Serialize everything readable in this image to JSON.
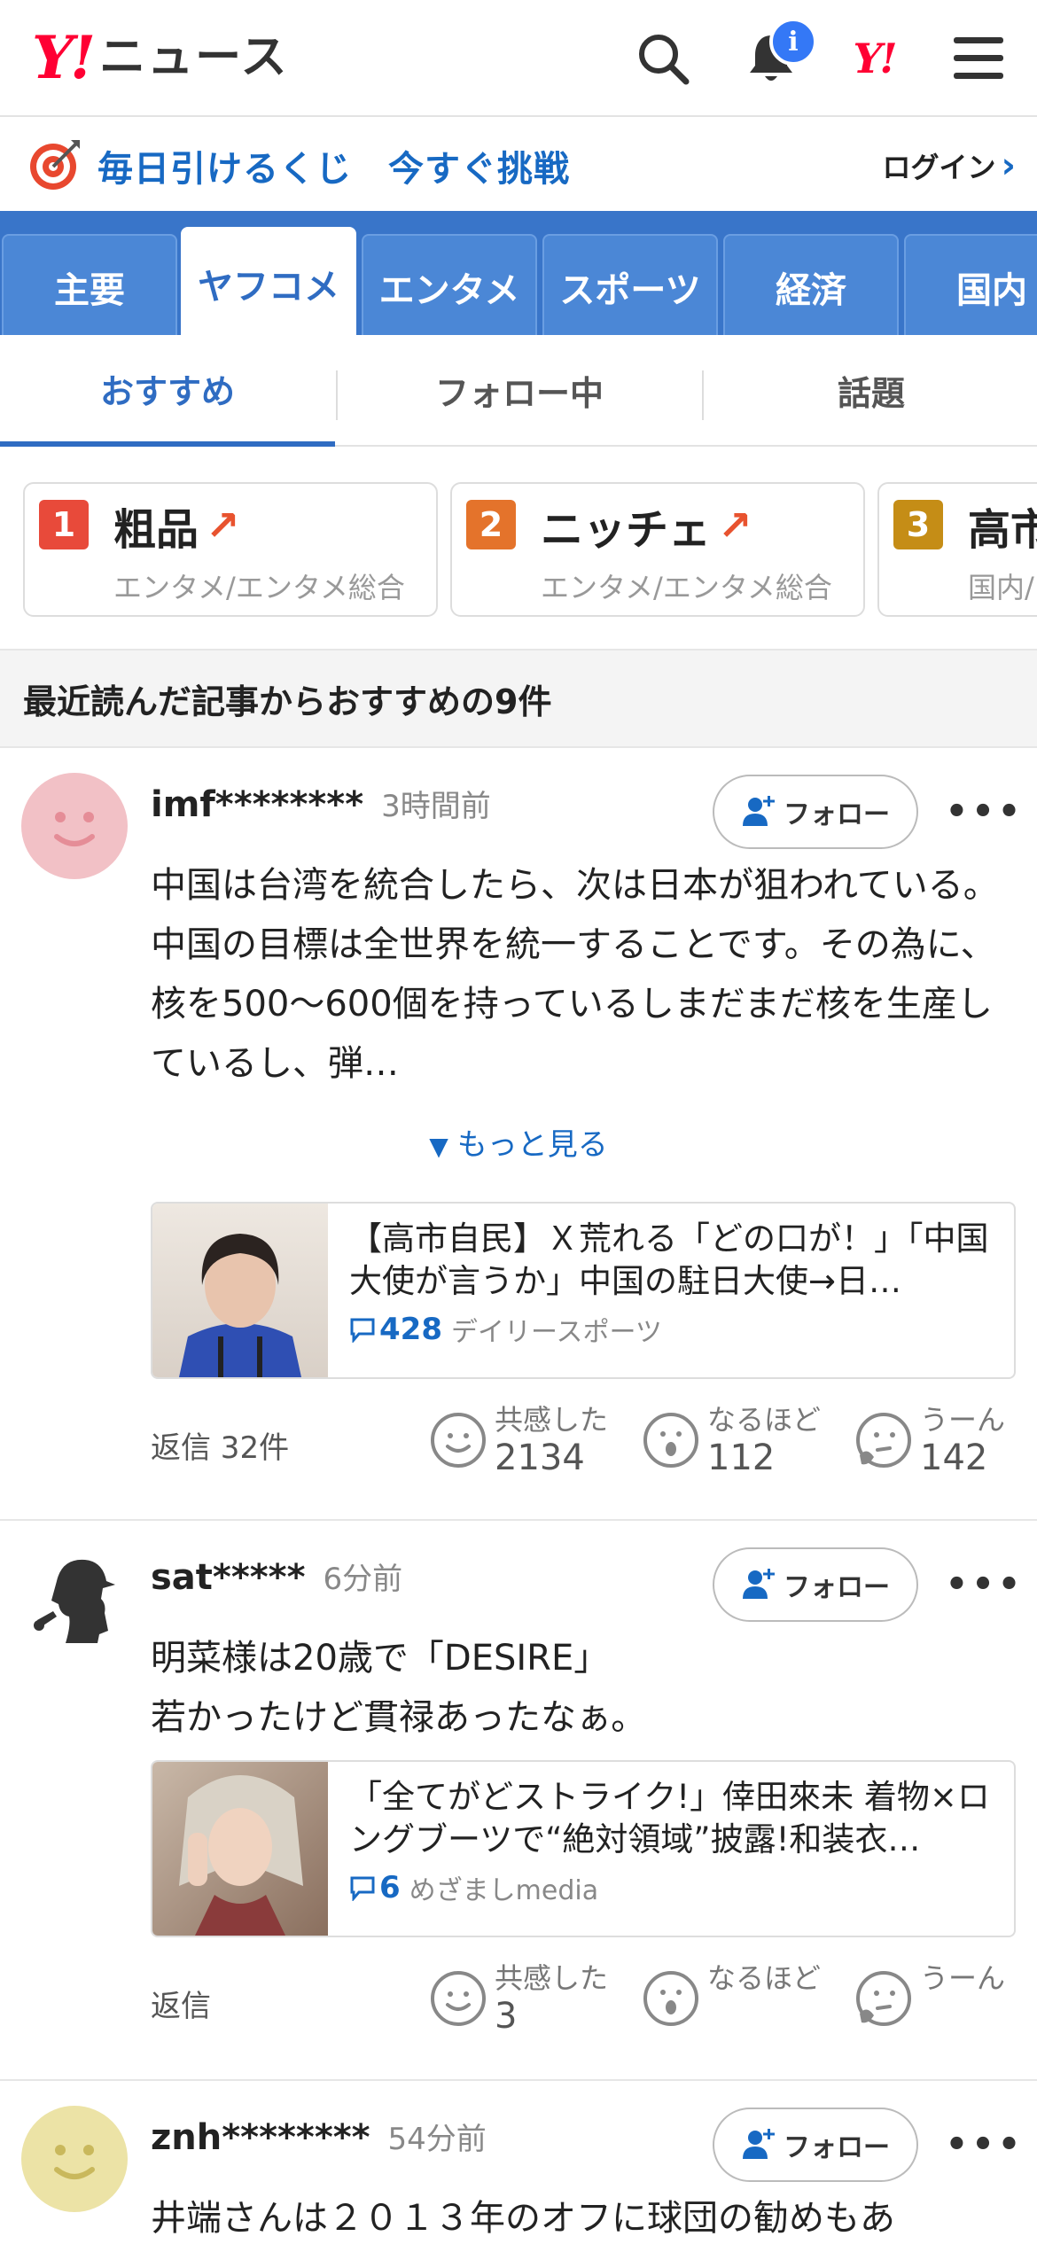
{
  "header": {
    "logo_mark": "Y!",
    "logo_text": "ニュース",
    "notification_badge": "i",
    "ylogo": "Y!"
  },
  "lottery": {
    "text": "毎日引けるくじ　今すぐ挑戦",
    "login": "ログイン",
    "login_chevron": "›"
  },
  "category_tabs": [
    "主要",
    "ヤフコメ",
    "エンタメ",
    "スポーツ",
    "経済",
    "国内"
  ],
  "sub_tabs": [
    "おすすめ",
    "フォロー中",
    "話題"
  ],
  "ranking": [
    {
      "rank": "1",
      "title": "粗品",
      "sub": "エンタメ/エンタメ総合",
      "color": "#e84a3a",
      "trend": "↗"
    },
    {
      "rank": "2",
      "title": "ニッチェ",
      "sub": "エンタメ/エンタメ総合",
      "color": "#e4732b",
      "trend": "↗"
    },
    {
      "rank": "3",
      "title": "高市",
      "sub": "国内/",
      "color": "#c58d16",
      "trend": ""
    }
  ],
  "section_heading": "最近読んだ記事からおすすめの9件",
  "follow_label": "フォロー",
  "more_dots": "•••",
  "comments": [
    {
      "user": "imf********",
      "time": "3時間前",
      "body": "中国は台湾を統合したら、次は日本が狙われている。中国の目標は全世界を統一することです。その為に、核を500〜600個を持っているしまだまだ核を生産しているし、弾…",
      "see_more": "もっと見る",
      "see_more_icon": "▼",
      "article_title": "【高市自民】Ｘ荒れる「どの口が！」「中国大使が言うか」中国の駐日大使→日…",
      "article_comments": "428",
      "article_source": "デイリースポーツ",
      "reply": "返信 32件",
      "reactions": [
        {
          "label": "共感した",
          "count": "2134"
        },
        {
          "label": "なるほど",
          "count": "112"
        },
        {
          "label": "うーん",
          "count": "142"
        }
      ]
    },
    {
      "user": "sat*****",
      "time": "6分前",
      "body": "明菜様は20歳で「DESIRE」\n若かったけど貫禄あったなぁ。",
      "article_title": "「全てがどストライク!」倖田來未 着物×ロングブーツで“絶対領域”披露!和装衣…",
      "article_comments": "6",
      "article_source": "めざましmedia",
      "reply": "返信",
      "reactions": [
        {
          "label": "共感した",
          "count": "3"
        },
        {
          "label": "なるほど",
          "count": ""
        },
        {
          "label": "うーん",
          "count": ""
        }
      ]
    },
    {
      "user": "znh********",
      "time": "54分前",
      "body": "井端さんは２０１３年のオフに球団の勧めもあ"
    }
  ],
  "colors": {
    "brand_red": "#ff0033",
    "link_blue": "#1769c3",
    "tab_blue": "#3975c9"
  }
}
